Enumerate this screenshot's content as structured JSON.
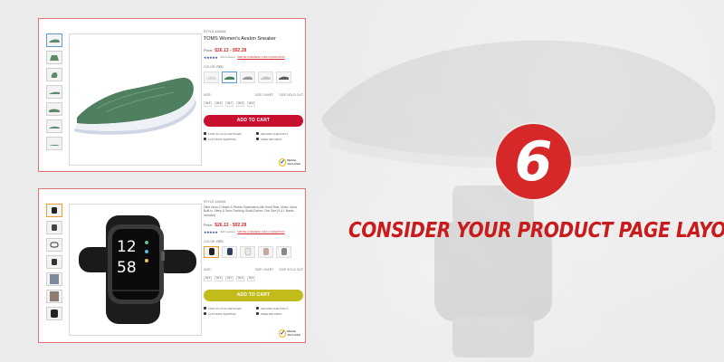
{
  "banner": {
    "step_number": "6",
    "headline": "CONSIDER YOUR PRODUCT PAGE LAYOUT",
    "accent_color": "#c91b1b"
  },
  "card_shoe": {
    "style_label": "STYLE #44401",
    "title": "TOMS Women's Avalon Sneaker",
    "price_prefix": "Price:",
    "price": "$26.13 - $92.28",
    "stars": "★★★★★",
    "review_count": "320 reviews",
    "review_link": "WRITE A REVIEW / ASK A QUESTION",
    "color_label": "COLOR:",
    "color_value": "RED",
    "size_label": "SIZE:",
    "size_chart": "SIZE CHART",
    "sold_out": "SIZE SOLD OUT",
    "sizes": [
      "US 5",
      "US 6",
      "US 7",
      "US 8",
      "US 9"
    ],
    "cart_label": "ADD TO CART",
    "cart_color": "#c8102e",
    "perks": [
      "FIND IN LOCAL RETAILER",
      "SECURE CHECKOUT",
      "FLAT RATE SHIPPING",
      "FREE RETURNS"
    ],
    "badge": "Norton",
    "badge_sub": "SECURED"
  },
  "card_watch": {
    "style_label": "STYLE #44401",
    "desc": "Fitbit Versa 2 Health & Fitness Smartwatch with Heart Rate, Music, Alexa Built-In, Sleep & Swim Tracking, Black/Carbon, One Size (S & L Bands Included)",
    "price_prefix": "Price:",
    "price": "$26.13 - $92.28",
    "stars": "★★★★★",
    "review_count": "320 reviews",
    "review_link": "WRITE A REVIEW / ASK A QUESTION",
    "color_label": "COLOR:",
    "color_value": "RED",
    "size_label": "SIZE:",
    "size_chart": "SIZE CHART",
    "sold_out": "SIZE SOLD OUT",
    "sizes": [
      "US 5",
      "US 6",
      "US 7",
      "US 8",
      "US 9"
    ],
    "cart_label": "ADD TO CART",
    "cart_color": "#c2bb1c",
    "perks": [
      "FIND IN LOCAL RETAILER",
      "SECURE CHECKOUT",
      "FLAT RATE SHIPPING",
      "FREE RETURNS"
    ],
    "badge": "Norton",
    "badge_sub": "SECURED"
  },
  "watch_face": {
    "time_hour": "12",
    "time_min": "58"
  }
}
